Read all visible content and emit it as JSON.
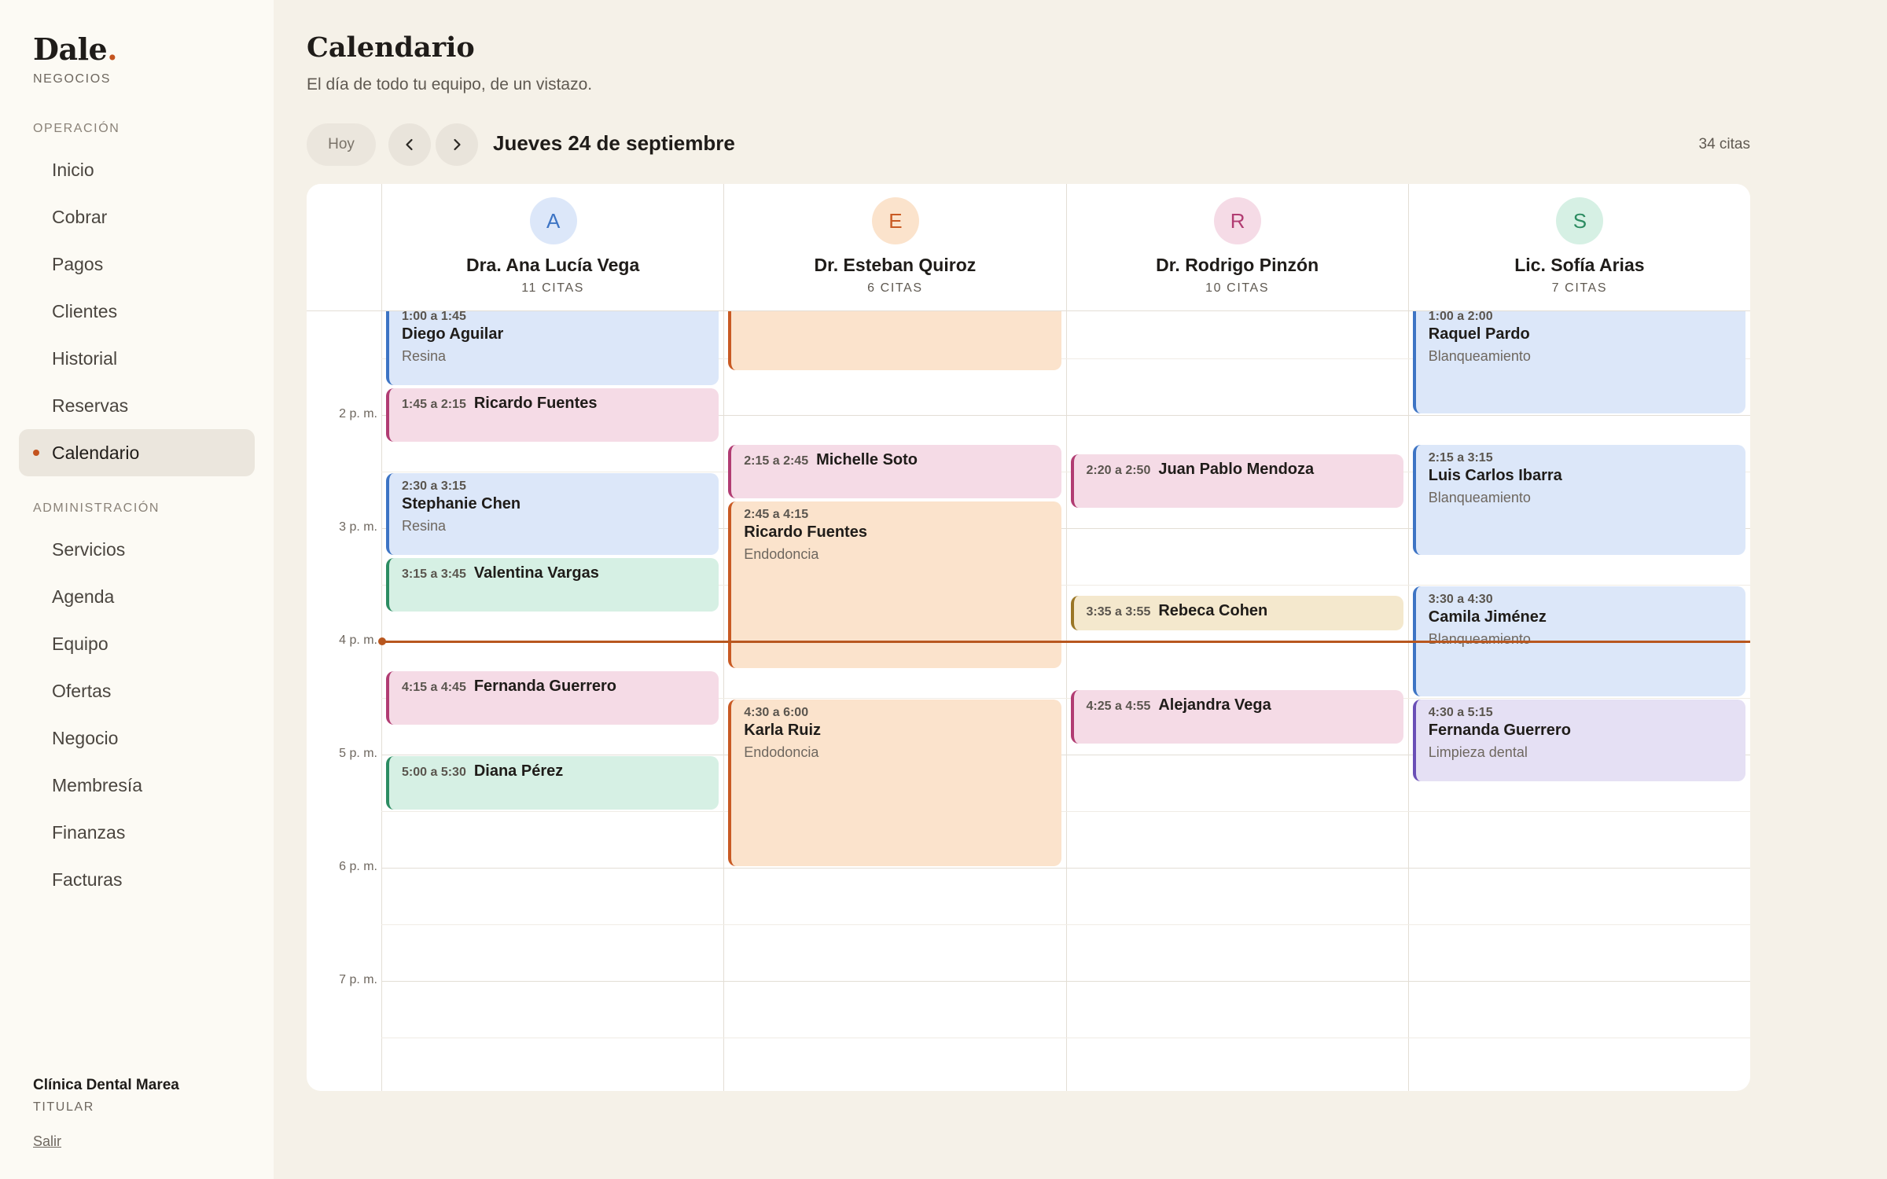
{
  "brand": {
    "name": "Dale",
    "dot": ".",
    "subtitle": "NEGOCIOS"
  },
  "sidebar": {
    "section_operacion": "OPERACIÓN",
    "operacion": [
      {
        "label": "Inicio"
      },
      {
        "label": "Cobrar"
      },
      {
        "label": "Pagos"
      },
      {
        "label": "Clientes"
      },
      {
        "label": "Historial"
      },
      {
        "label": "Reservas"
      },
      {
        "label": "Calendario",
        "active": true
      }
    ],
    "section_admin": "ADMINISTRACIÓN",
    "administracion": [
      {
        "label": "Servicios"
      },
      {
        "label": "Agenda"
      },
      {
        "label": "Equipo"
      },
      {
        "label": "Ofertas"
      },
      {
        "label": "Negocio"
      },
      {
        "label": "Membresía"
      },
      {
        "label": "Finanzas"
      },
      {
        "label": "Facturas"
      }
    ],
    "org_name": "Clínica Dental Marea",
    "org_role": "TITULAR",
    "logout": "Salir"
  },
  "header": {
    "title": "Calendario",
    "subtitle": "El día de todo tu equipo, de un vistazo.",
    "today_button": "Hoy",
    "prev_icon": "chevron-left-icon",
    "next_icon": "chevron-right-icon",
    "date": "Jueves 24 de septiembre",
    "count": "34 citas"
  },
  "calendar": {
    "time_labels": [
      "2 p. m.",
      "3 p. m.",
      "4 p. m.",
      "5 p. m.",
      "6 p. m.",
      "7 p. m."
    ],
    "now_time": "4:00",
    "staff": [
      {
        "initial": "A",
        "name": "Dra. Ana Lucía Vega",
        "count": "11 CITAS",
        "avatar_bg": "#dce7f9",
        "avatar_fg": "#3d74c4"
      },
      {
        "initial": "E",
        "name": "Dr. Esteban Quiroz",
        "count": "6 CITAS",
        "avatar_bg": "#fbe3cc",
        "avatar_fg": "#c95a23"
      },
      {
        "initial": "R",
        "name": "Dr. Rodrigo Pinzón",
        "count": "10 CITAS",
        "avatar_bg": "#f5dbe6",
        "avatar_fg": "#b13c72"
      },
      {
        "initial": "S",
        "name": "Lic. Sofía Arias",
        "count": "7 CITAS",
        "avatar_bg": "#d6f0e4",
        "avatar_fg": "#2c8c61"
      }
    ],
    "appointments": [
      {
        "col": 0,
        "start": "1:00",
        "end": "1:45",
        "time": "1:00 a 1:45",
        "name": "Diego Aguilar",
        "service": "Resina",
        "color": "blue"
      },
      {
        "col": 0,
        "start": "1:45",
        "end": "2:15",
        "time": "1:45 a 2:15",
        "name": "Ricardo Fuentes",
        "color": "pink"
      },
      {
        "col": 0,
        "start": "2:30",
        "end": "3:15",
        "time": "2:30 a 3:15",
        "name": "Stephanie Chen",
        "service": "Resina",
        "color": "blue"
      },
      {
        "col": 0,
        "start": "3:15",
        "end": "3:45",
        "time": "3:15 a 3:45",
        "name": "Valentina Vargas",
        "color": "green"
      },
      {
        "col": 0,
        "start": "4:15",
        "end": "4:45",
        "time": "4:15 a 4:45",
        "name": "Fernanda Guerrero",
        "color": "pink"
      },
      {
        "col": 0,
        "start": "5:00",
        "end": "5:30",
        "time": "5:00 a 5:30",
        "name": "Diana Pérez",
        "color": "green"
      },
      {
        "col": 1,
        "start": "1:00",
        "end": "1:37",
        "color": "peach"
      },
      {
        "col": 1,
        "start": "2:15",
        "end": "2:45",
        "time": "2:15 a 2:45",
        "name": "Michelle Soto",
        "color": "pink"
      },
      {
        "col": 1,
        "start": "2:45",
        "end": "4:15",
        "time": "2:45 a 4:15",
        "name": "Ricardo Fuentes",
        "service": "Endodoncia",
        "color": "peach"
      },
      {
        "col": 1,
        "start": "4:30",
        "end": "6:00",
        "time": "4:30 a 6:00",
        "name": "Karla Ruiz",
        "service": "Endodoncia",
        "color": "peach"
      },
      {
        "col": 2,
        "start": "2:20",
        "end": "2:50",
        "time": "2:20 a 2:50",
        "name": "Juan Pablo Mendoza",
        "color": "pink"
      },
      {
        "col": 2,
        "start": "3:35",
        "end": "3:55",
        "time": "3:35 a 3:55",
        "name": "Rebeca Cohen",
        "color": "sand"
      },
      {
        "col": 2,
        "start": "4:25",
        "end": "4:55",
        "time": "4:25 a 4:55",
        "name": "Alejandra Vega",
        "color": "pink"
      },
      {
        "col": 3,
        "start": "1:00",
        "end": "2:00",
        "time": "1:00 a 2:00",
        "name": "Raquel Pardo",
        "service": "Blanqueamiento",
        "color": "blue"
      },
      {
        "col": 3,
        "start": "2:15",
        "end": "3:15",
        "time": "2:15 a 3:15",
        "name": "Luis Carlos Ibarra",
        "service": "Blanqueamiento",
        "color": "blue"
      },
      {
        "col": 3,
        "start": "3:30",
        "end": "4:30",
        "time": "3:30 a 4:30",
        "name": "Camila Jiménez",
        "service": "Blanqueamiento",
        "color": "blue"
      },
      {
        "col": 3,
        "start": "4:30",
        "end": "5:15",
        "time": "4:30 a 5:15",
        "name": "Fernanda Guerrero",
        "service": "Limpieza dental",
        "color": "lav"
      }
    ]
  }
}
